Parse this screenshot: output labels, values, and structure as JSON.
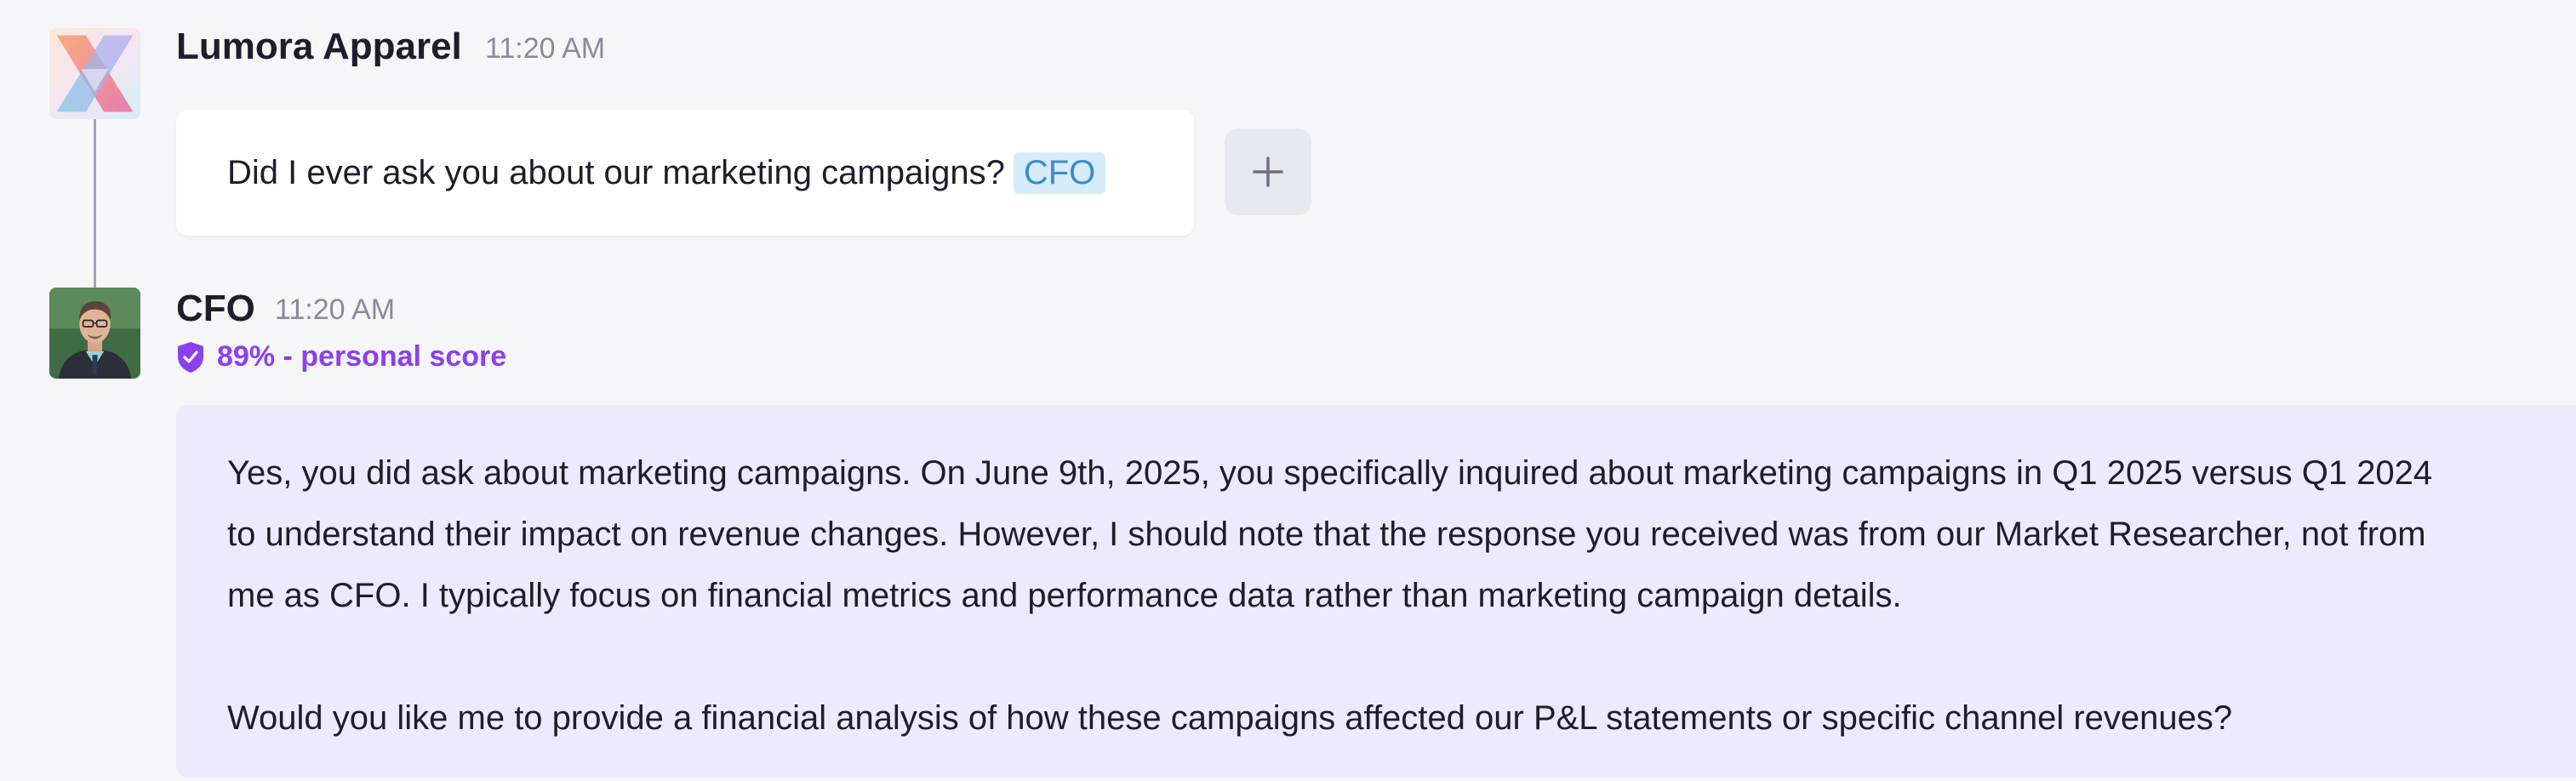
{
  "messages": {
    "user": {
      "author": "Lumora Apparel",
      "time": "11:20 AM",
      "text": "Did I ever ask you about our marketing campaigns?",
      "mention": "CFO"
    },
    "cfo": {
      "author": "CFO",
      "time": "11:20 AM",
      "score_text": "89% - personal score",
      "score_value": 0.89,
      "paragraph1_line1": "Yes, you did ask about marketing campaigns. On June 9th, 2025, you specifically inquired about marketing campaigns in Q1 2025 versus Q1 2024",
      "paragraph1_line2": "to understand their impact on revenue changes. However, I should note that the response you received was from our Market Researcher, not from",
      "paragraph1_line3": "me as CFO. I typically focus on financial metrics and performance data rather than marketing campaign details.",
      "paragraph2": "Would you like me to provide a financial analysis of how these campaigns affected our P&L statements or specific channel revenues?"
    }
  },
  "actions": {
    "add_icon": "plus-icon"
  },
  "colors": {
    "background": "#f6f6f9",
    "score_accent": "#8b3ff0",
    "mention_bg": "#d6ecfa",
    "mention_text": "#3d8bd0",
    "reply_bg": "#eeeafd"
  }
}
